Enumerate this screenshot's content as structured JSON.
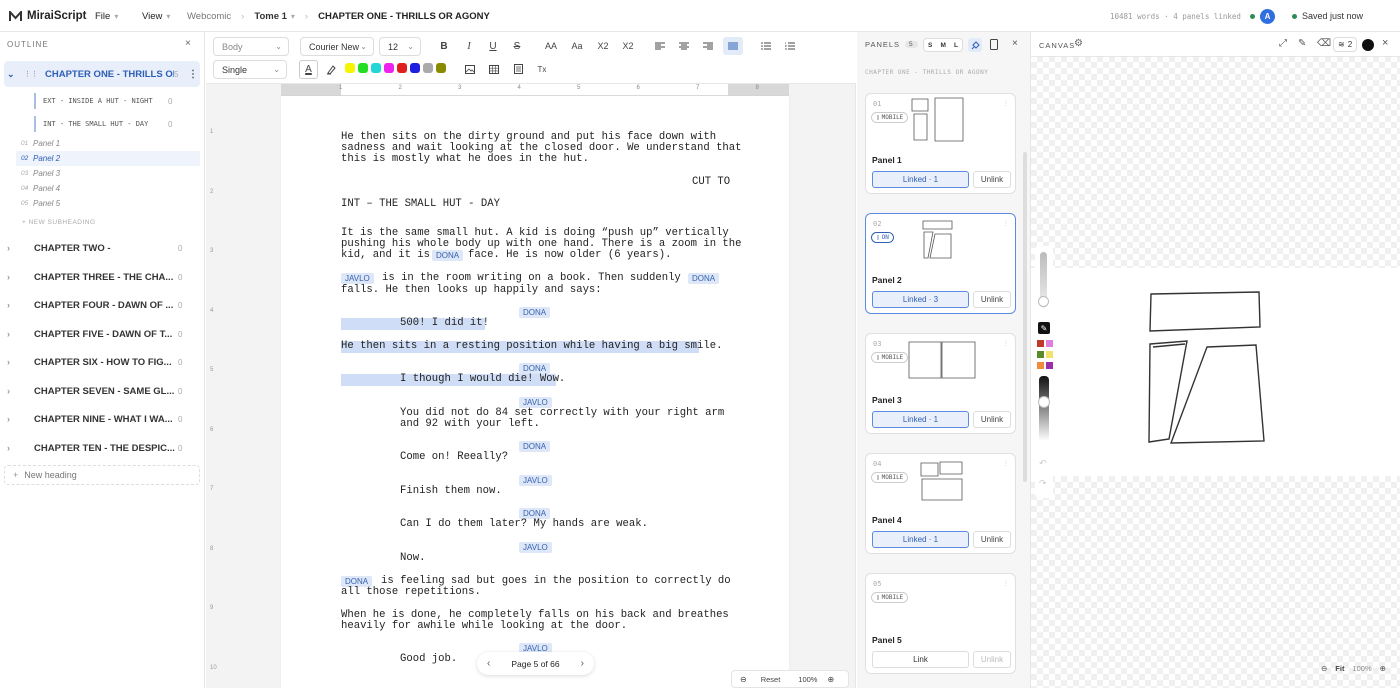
{
  "app": {
    "name": "MiraiScript",
    "menu": [
      "File",
      "View"
    ]
  },
  "breadcrumb": {
    "project": "Webcomic",
    "tome": "Tome 1",
    "chapter": "CHAPTER ONE - THRILLS OR AGONY"
  },
  "status": {
    "stats": "10481 words · 4 panels linked",
    "avatar": "A",
    "saved": "Saved just now"
  },
  "outline": {
    "heading": "OUTLINE",
    "active_chapter": {
      "title": "CHAPTER ONE - THRILLS OR...",
      "count": "5"
    },
    "subheadings": [
      {
        "label": "EXT - INSIDE A HUT - NIGHT",
        "count": "0"
      },
      {
        "label": "INT - THE SMALL HUT - DAY",
        "count": "0"
      }
    ],
    "panels": [
      {
        "num": "01",
        "label": "Panel 1"
      },
      {
        "num": "02",
        "label": "Panel 2"
      },
      {
        "num": "03",
        "label": "Panel 3"
      },
      {
        "num": "04",
        "label": "Panel 4"
      },
      {
        "num": "05",
        "label": "Panel 5"
      }
    ],
    "new_subheading": "+ NEW SUBHEADING",
    "chapters": [
      {
        "title": "CHAPTER TWO -",
        "count": "0"
      },
      {
        "title": "CHAPTER THREE - THE CHA...",
        "count": "0"
      },
      {
        "title": "CHAPTER FOUR - DAWN OF ...",
        "count": "0"
      },
      {
        "title": "CHAPTER FIVE - DAWN OF T...",
        "count": "0"
      },
      {
        "title": "CHAPTER SIX - HOW TO FIG...",
        "count": "0"
      },
      {
        "title": "CHAPTER SEVEN - SAME GL...",
        "count": "0"
      },
      {
        "title": "CHAPTER NINE - WHAT I WA...",
        "count": "0"
      },
      {
        "title": "CHAPTER TEN - THE DESPIC...",
        "count": "0"
      }
    ],
    "new_heading": "New heading"
  },
  "toolbar": {
    "style": "Body",
    "font": "Courier New",
    "size": "12",
    "spacing": "Single",
    "bold": "B",
    "italic": "I",
    "underline": "U",
    "strike": "S",
    "upper": "AA",
    "lower": "Aa",
    "sub": "X2",
    "sup": "X2",
    "clear": "Tx",
    "text_color": "A",
    "colors": [
      "#f5f500",
      "#22dd22",
      "#22d6d6",
      "#ee22ee",
      "#e01f1f",
      "#1e1ee0",
      "#aaaaaa",
      "#8a8a00"
    ]
  },
  "ruler": {
    "labels": [
      "1",
      "2",
      "3",
      "4",
      "5",
      "6",
      "7",
      "8"
    ],
    "left_numbers": [
      "1",
      "2",
      "3",
      "4",
      "5",
      "6",
      "7",
      "8",
      "9",
      "10"
    ]
  },
  "script": {
    "p1": [
      "He then sits on the dirty ground and put his face down with",
      "sadness and wait looking at the closed door. We understand that",
      "this is mostly what he does in the hut."
    ],
    "transition": "CUT TO",
    "heading": "INT – THE SMALL HUT - DAY",
    "p2": [
      "It is the same small hut. A kid is doing “push up” vertically",
      "pushing his whole body up with one hand. There is a zoom in the",
      "kid, and it is"
    ],
    "p2_end": "face. He is now older (6 years).",
    "char_dona": "DONA",
    "char_javlo": "JAVLO",
    "p3a": "is in the room writing on a book. Then suddenly",
    "p3b": "falls. He then looks up happily and says:",
    "d1": "500! I did it!",
    "a1": "He then sits in a resting position while having a big smile.",
    "d2": "I though I would die! Wow.",
    "d3": [
      "You did not do 84 set correctly with your right arm",
      "and 92 with your left."
    ],
    "d4": "Come on! Reeally?",
    "d5": "Finish them now.",
    "d6": "Can I do them later? My hands are weak.",
    "d7": "Now.",
    "p4a": "is feeling sad but goes in the position to correctly do",
    "p4b": "all those repetitions.",
    "p5": [
      "When he is done, he completely falls on his back and breathes",
      "heavily for awhile while looking at the door."
    ],
    "d8": "Good job."
  },
  "pager": {
    "label": "Page 5 of 66",
    "reset": "Reset",
    "zoom": "100%"
  },
  "panels_side": {
    "title": "PANELS",
    "count": "5",
    "sizes": [
      "S",
      "M",
      "L"
    ],
    "chapter": "CHAPTER ONE - THRILLS OR AGONY",
    "cards": [
      {
        "num": "01",
        "chip": "MOBILE",
        "title": "Panel 1",
        "link": "Linked · 1",
        "unlink": "Unlink"
      },
      {
        "num": "02",
        "chip": "ON",
        "title": "Panel 2",
        "link": "Linked · 3",
        "unlink": "Unlink"
      },
      {
        "num": "03",
        "chip": "MOBILE",
        "title": "Panel 3",
        "link": "Linked · 1",
        "unlink": "Unlink"
      },
      {
        "num": "04",
        "chip": "MOBILE",
        "title": "Panel 4",
        "link": "Linked · 1",
        "unlink": "Unlink"
      },
      {
        "num": "05",
        "chip": "MOBILE",
        "title": "Panel 5",
        "link": "Link",
        "unlink": "Unlink"
      }
    ]
  },
  "canvas": {
    "title": "CANVAS",
    "layers": "2",
    "fit": "Fit",
    "zoom": "100%",
    "palette": [
      "#c0392b",
      "#e07ee0",
      "#5a8a2a",
      "#f2e16b",
      "#f08a3c",
      "#9b2fa8"
    ]
  }
}
